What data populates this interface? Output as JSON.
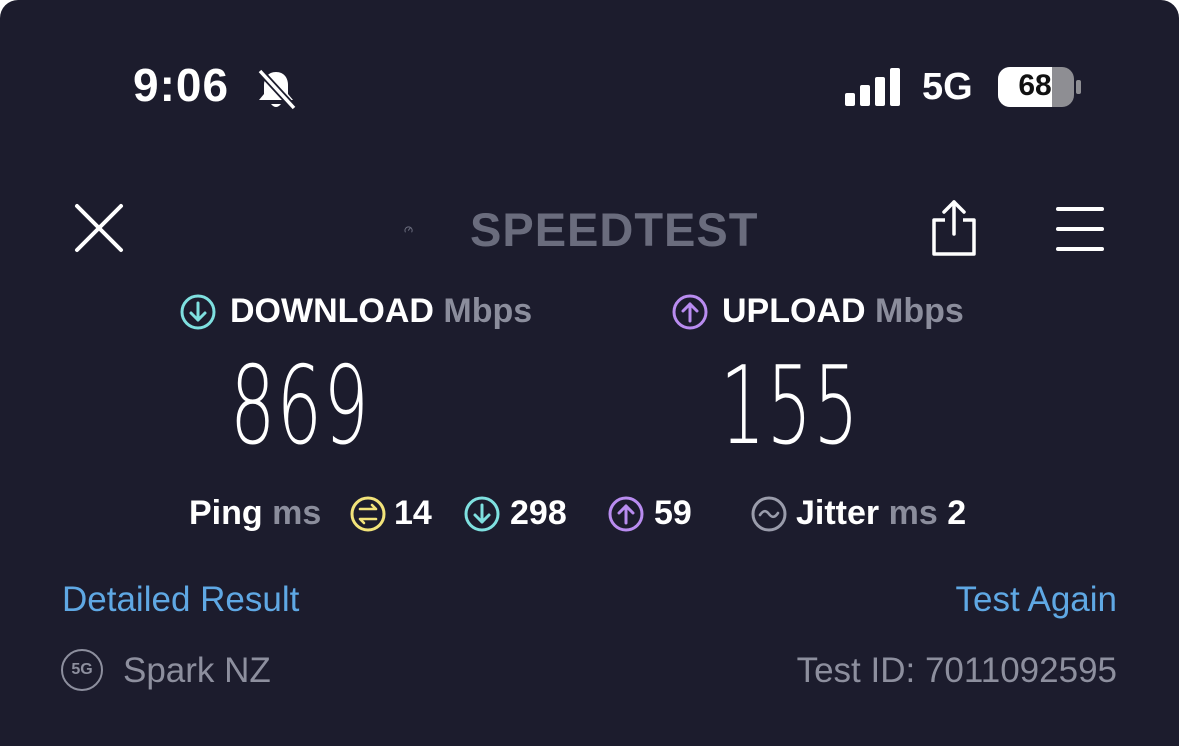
{
  "status_bar": {
    "time": "9:06",
    "network": "5G",
    "battery": "68"
  },
  "header": {
    "logo_text": "SPEEDTEST"
  },
  "download": {
    "label": "DOWNLOAD",
    "unit": "Mbps",
    "value": "869"
  },
  "upload": {
    "label": "UPLOAD",
    "unit": "Mbps",
    "value": "155"
  },
  "ping": {
    "label": "Ping",
    "unit": "ms",
    "idle": "14",
    "download": "298",
    "upload": "59"
  },
  "jitter": {
    "label": "Jitter",
    "unit": "ms",
    "value": "2"
  },
  "links": {
    "detailed": "Detailed Result",
    "again": "Test Again"
  },
  "footer": {
    "badge": "5G",
    "provider": "Spark NZ",
    "test_id": "Test ID: 7011092595"
  },
  "colors": {
    "background": "#1c1c2d",
    "download_accent": "#7fe0e0",
    "upload_accent": "#b98cf0",
    "ping_accent": "#f2e37a",
    "link": "#5fa8e4"
  }
}
